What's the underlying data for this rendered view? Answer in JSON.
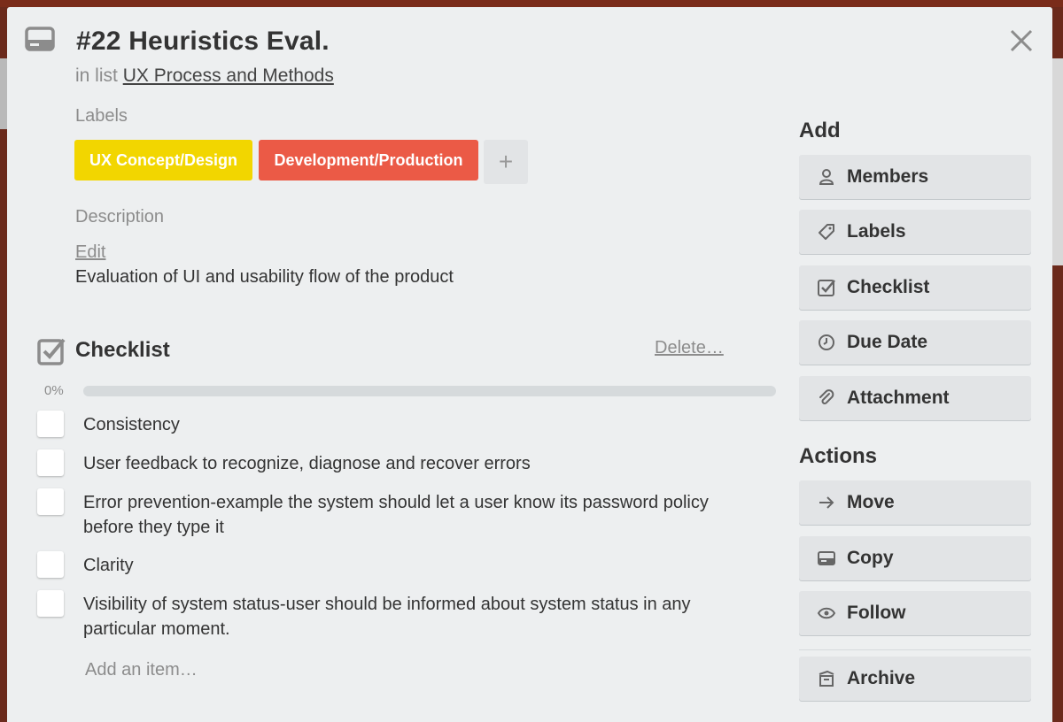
{
  "card": {
    "title": "#22 Heuristics Eval.",
    "in_list_prefix": "in list",
    "list_name": "UX Process and Methods"
  },
  "labels": {
    "heading": "Labels",
    "items": [
      {
        "text": "UX Concept/Design",
        "color": "#f2d600"
      },
      {
        "text": "Development/Production",
        "color": "#eb5a46"
      }
    ],
    "add_symbol": "+"
  },
  "description": {
    "heading": "Description",
    "edit_label": "Edit",
    "text": "Evaluation of UI and usability flow of the product"
  },
  "checklist": {
    "title": "Checklist",
    "delete_label": "Delete…",
    "progress_label": "0%",
    "progress": 0,
    "items": [
      {
        "text": "Consistency",
        "checked": false
      },
      {
        "text": "User feedback to recognize, diagnose and recover errors",
        "checked": false
      },
      {
        "text": "Error prevention-example the system should let a user know its password policy before they type it",
        "checked": false
      },
      {
        "text": "Clarity",
        "checked": false
      },
      {
        "text": "Visibility of system status-user should be informed about system status in any particular moment.",
        "checked": false
      }
    ],
    "add_item_placeholder": "Add an item…"
  },
  "sidebar": {
    "add_heading": "Add",
    "add_buttons": [
      {
        "label": "Members",
        "icon": "member-icon"
      },
      {
        "label": "Labels",
        "icon": "label-icon"
      },
      {
        "label": "Checklist",
        "icon": "checklist-icon"
      },
      {
        "label": "Due Date",
        "icon": "clock-icon"
      },
      {
        "label": "Attachment",
        "icon": "paperclip-icon"
      }
    ],
    "actions_heading": "Actions",
    "action_buttons": [
      {
        "label": "Move",
        "icon": "arrow-right-icon"
      },
      {
        "label": "Copy",
        "icon": "card-icon"
      },
      {
        "label": "Follow",
        "icon": "eye-icon"
      },
      {
        "label": "Archive",
        "icon": "archive-icon"
      }
    ]
  },
  "colors": {
    "modal_bg": "#edeff0",
    "button_bg": "#e2e4e6",
    "muted_text": "#8c8c8c"
  }
}
